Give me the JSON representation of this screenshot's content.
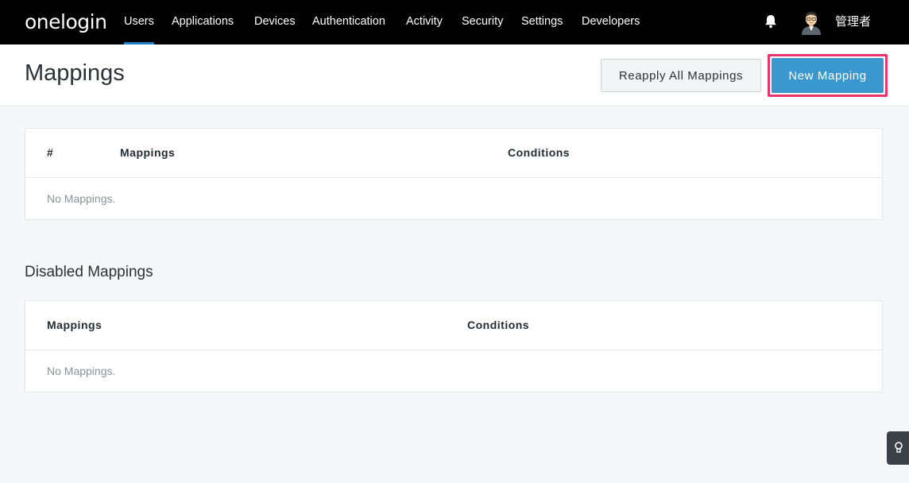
{
  "nav": {
    "logo": "onelogin",
    "items": [
      {
        "label": "Users",
        "active": true
      },
      {
        "label": "Applications"
      },
      {
        "label": "Devices"
      },
      {
        "label": "Authentication"
      },
      {
        "label": "Activity"
      },
      {
        "label": "Security"
      },
      {
        "label": "Settings"
      },
      {
        "label": "Developers"
      }
    ],
    "bell_icon": "bell-icon",
    "user_name": "管理者"
  },
  "header": {
    "title": "Mappings",
    "reapply_label": "Reapply All Mappings",
    "new_label": "New Mapping",
    "highlight_color": "#e8336c",
    "primary_color": "#3a98cf"
  },
  "mappings_table": {
    "columns": [
      "#",
      "Mappings",
      "Conditions"
    ],
    "empty_text": "No Mappings."
  },
  "disabled_section": {
    "title": "Disabled Mappings",
    "columns": [
      "Mappings",
      "Conditions"
    ],
    "empty_text": "No Mappings."
  },
  "help": {
    "icon": "lightbulb-icon"
  }
}
